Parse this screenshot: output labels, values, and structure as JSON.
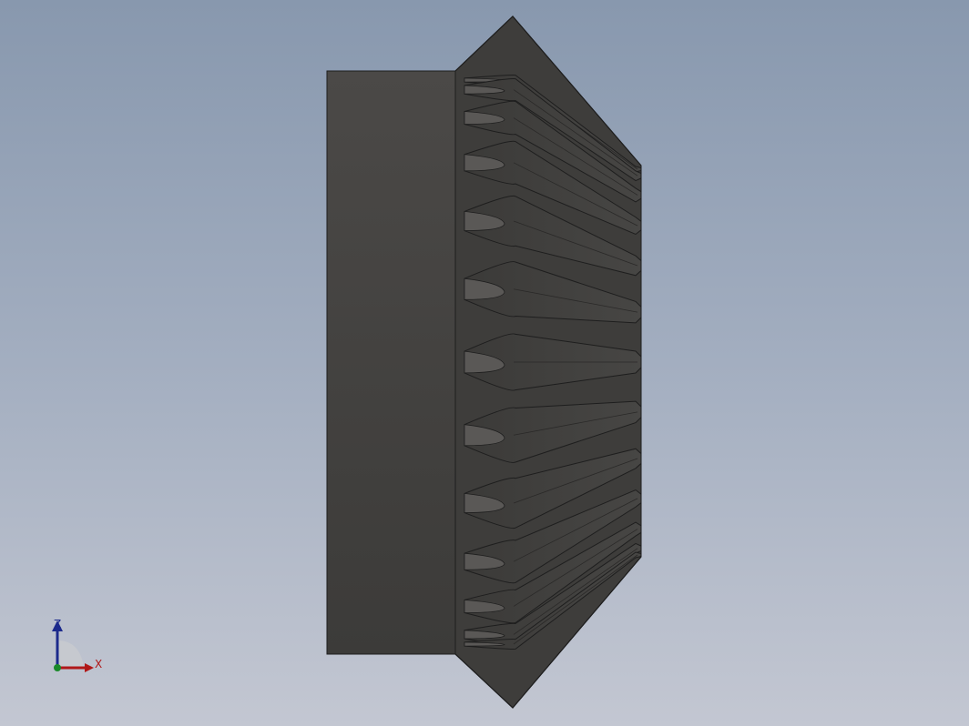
{
  "viewport": {
    "background_top": "#8898ae",
    "background_bottom": "#c3c7d2"
  },
  "model": {
    "name": "bevel-gear",
    "hub_color": "#45433f",
    "tooth_color": "#434240",
    "edge_color": "#1e1e1e",
    "tooth_count_visible": 13
  },
  "triad": {
    "z_label": "Z",
    "x_label": "X",
    "z_color": "#1c2a8c",
    "x_color": "#b01818",
    "y_color": "#1a8a2a"
  }
}
